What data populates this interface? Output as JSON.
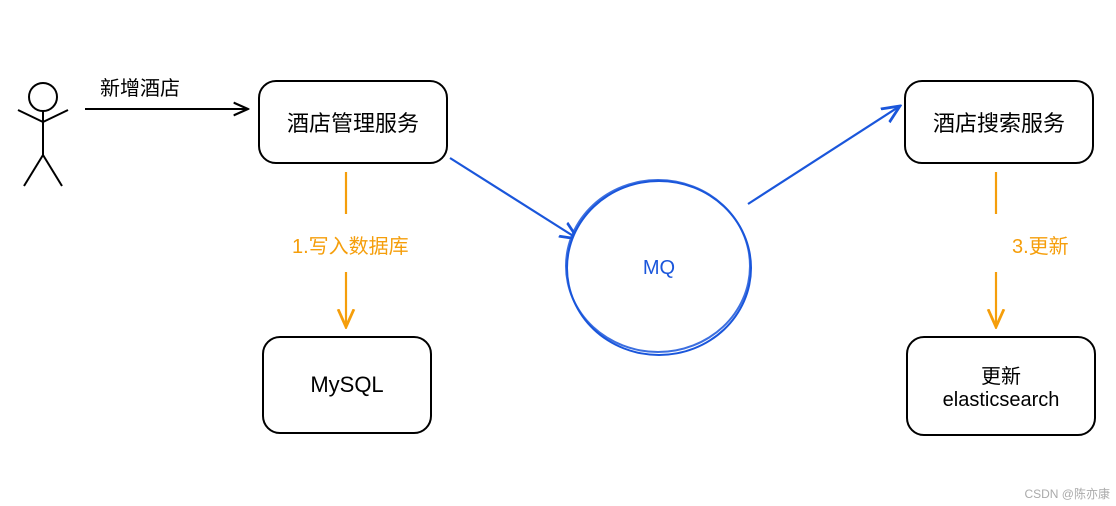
{
  "diagram": {
    "actor_label": "新增酒店",
    "nodes": {
      "hotel_admin": "酒店管理服务",
      "mq": "MQ",
      "hotel_search": "酒店搜索服务",
      "mysql": "MySQL",
      "es_line1": "更新",
      "es_line2": "elasticsearch"
    },
    "edges": {
      "write_db": "1.写入数据库",
      "update": "3.更新"
    },
    "watermark": "CSDN @陈亦康",
    "colors": {
      "blue": "#1a56db",
      "orange": "#f59e0b",
      "black": "#000000"
    }
  }
}
